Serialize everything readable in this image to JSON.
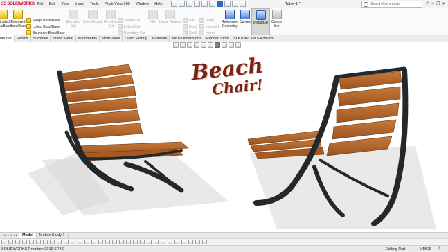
{
  "app": {
    "logo_prefix": "3S",
    "logo_text": "SOLIDWORKS",
    "document_title": "Table-1 *",
    "menus": [
      "File",
      "Edit",
      "View",
      "Insert",
      "Tools",
      "PhotoView 360",
      "Window",
      "Help"
    ],
    "search_placeholder": "Search Commands",
    "window_controls": [
      "?",
      "–",
      "❐",
      "✕"
    ]
  },
  "command_manager": {
    "large_buttons": [
      {
        "label": "Extruded\nBoss/Base",
        "icon": "extruded-boss-icon",
        "enabled": true
      },
      {
        "label": "Revolved\nBoss/Base",
        "icon": "revolved-boss-icon",
        "enabled": true
      },
      {
        "label": "Extruded\nCut",
        "icon": "extruded-cut-icon",
        "enabled": false
      },
      {
        "label": "Hole Wizard",
        "icon": "hole-wizard-icon",
        "enabled": false
      },
      {
        "label": "Revolved\nCut",
        "icon": "revolved-cut-icon",
        "enabled": false
      },
      {
        "label": "Fillet",
        "icon": "fillet-icon",
        "enabled": false
      },
      {
        "label": "Linear Pattern",
        "icon": "linear-pattern-icon",
        "enabled": false
      },
      {
        "label": "Reference\nGeometry",
        "icon": "reference-geometry-icon",
        "enabled": true
      },
      {
        "label": "Curves",
        "icon": "curves-icon",
        "enabled": true
      },
      {
        "label": "Instant3D",
        "icon": "instant3d-icon",
        "enabled": true
      },
      {
        "label": "Centre\nline",
        "icon": "centreline-icon",
        "enabled": true
      }
    ],
    "boss_group": [
      "Swept Boss/Base",
      "Lofted Boss/Base",
      "Boundary Boss/Base"
    ],
    "cut_group": [
      "Swept Cut",
      "Lofted Cut",
      "Boundary Cut"
    ],
    "rib_group": [
      "Rib",
      "Draft",
      "Shell"
    ],
    "wrap_group": [
      "Wrap",
      "Intersect",
      "Mirror"
    ]
  },
  "tabs": [
    "Features",
    "Sketch",
    "Surfaces",
    "Sheet Metal",
    "Weldments",
    "Mold Tools",
    "Direct Editing",
    "Evaluate",
    "MBD Dimensions",
    "Render Tools",
    "SOLIDWORKS Add-Ins"
  ],
  "active_tab": "Features",
  "graphics": {
    "title_line1": "Beach",
    "title_line2": "Chair!",
    "colors": {
      "wood": "#b5662a",
      "wood_dark": "#8a4a1c",
      "frame": "#2b2e31",
      "title": "#7a2418"
    }
  },
  "bottom": {
    "nav_arrows": [
      "◂◂",
      "◂",
      "▸",
      "▸▸"
    ],
    "tabs": [
      "Model",
      "Motion Study 1"
    ],
    "active_tab": "Model"
  },
  "status": {
    "product": "SOLIDWORKS Premium 2019 SP3.0",
    "mode": "Editing Part",
    "units": "MMGS"
  }
}
